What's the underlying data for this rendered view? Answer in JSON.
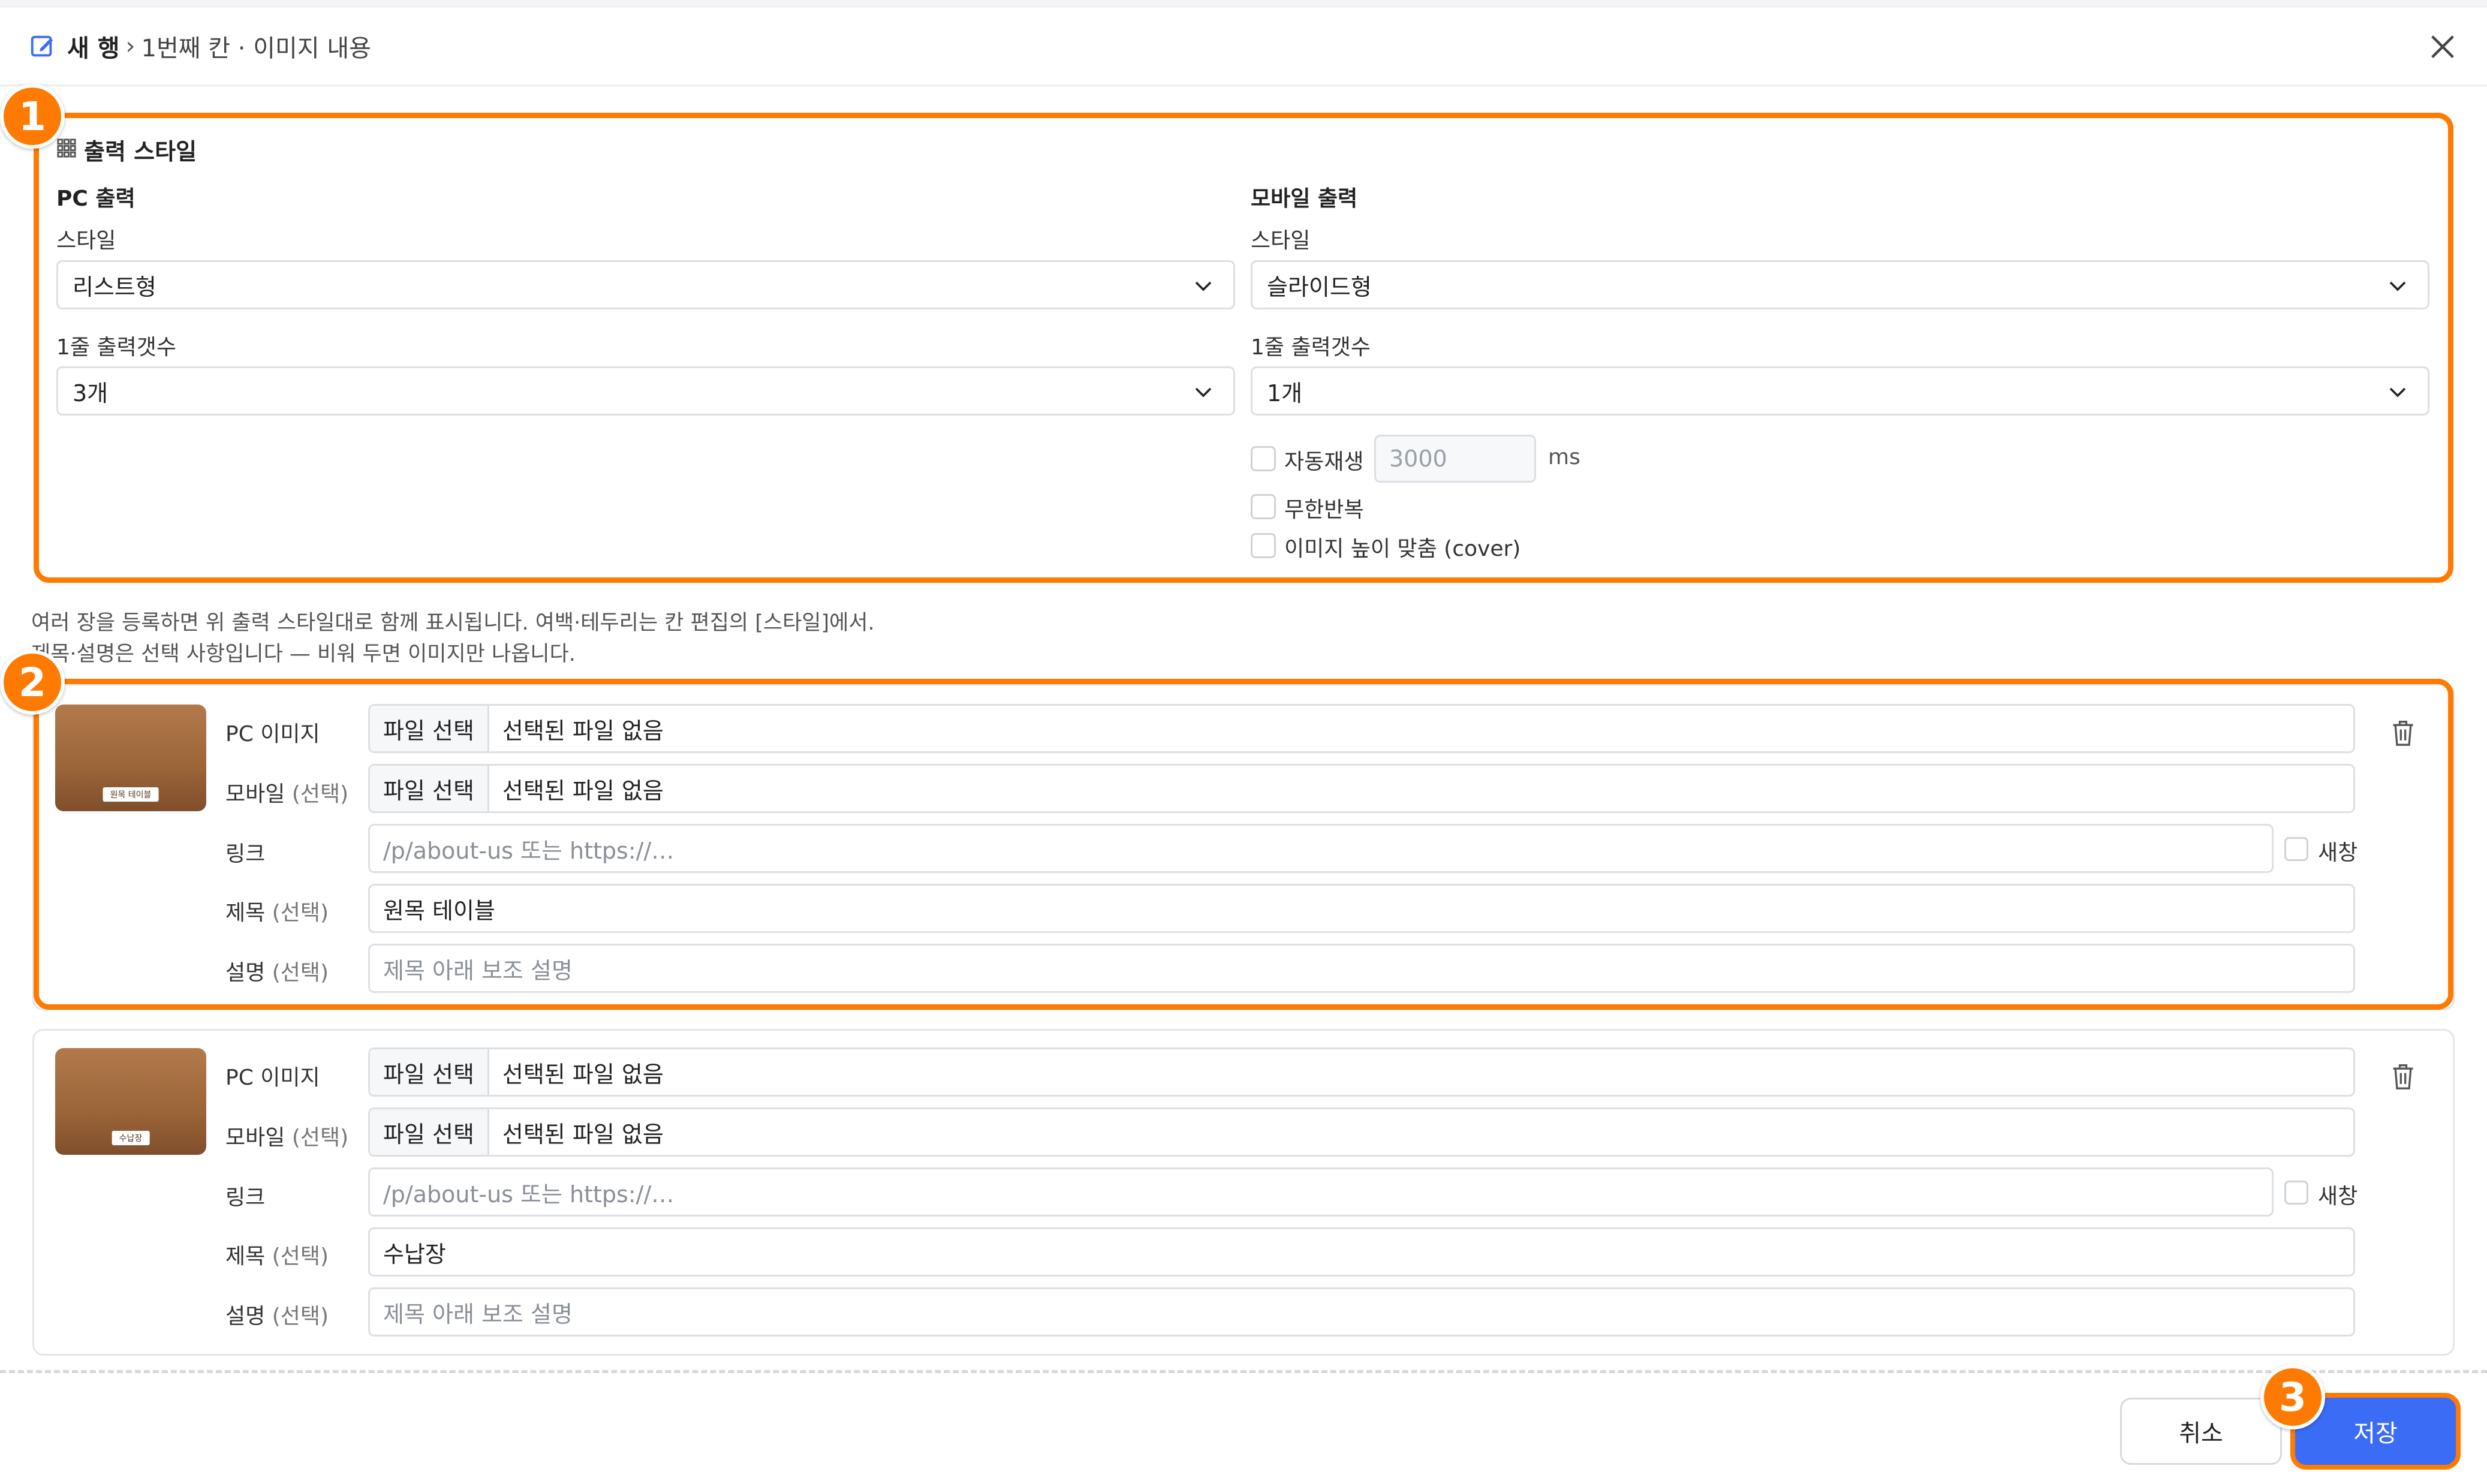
{
  "header": {
    "title": "새 행",
    "separator": "›",
    "breadcrumb": "1번째 칸 · 이미지 내용"
  },
  "style_section": {
    "title": "출력 스타일",
    "pc": {
      "heading": "PC 출력",
      "style_label": "스타일",
      "style_value": "리스트형",
      "count_label": "1줄 출력갯수",
      "count_value": "3개"
    },
    "mobile": {
      "heading": "모바일 출력",
      "style_label": "스타일",
      "style_value": "슬라이드형",
      "count_label": "1줄 출력갯수",
      "count_value": "1개",
      "autoplay_label": "자동재생",
      "autoplay_value": "3000",
      "autoplay_unit": "ms",
      "loop_label": "무한반복",
      "cover_label": "이미지 높이 맞춤 (cover)"
    }
  },
  "help_text": {
    "line1": "여러 장을 등록하면 위 출력 스타일대로 함께 표시됩니다. 여백·테두리는 칸 편집의 [스타일]에서.",
    "line2": "제목·설명은 선택 사항입니다 — 비워 두면 이미지만 나옵니다."
  },
  "labels": {
    "pc_image": "PC 이미지",
    "mobile_main": "모바일",
    "optional": "(선택)",
    "link": "링크",
    "title_main": "제목",
    "desc_main": "설명",
    "file_button": "파일 선택",
    "no_file": "선택된 파일 없음",
    "link_placeholder": "/p/about-us 또는 https://…",
    "new_window": "새창",
    "desc_placeholder": "제목 아래 보조 설명"
  },
  "items": [
    {
      "thumb_tag": "원목 테이블",
      "title_value": "원목 테이블"
    },
    {
      "thumb_tag": "수납장",
      "title_value": "수납장"
    }
  ],
  "footer": {
    "cancel": "취소",
    "save": "저장"
  },
  "badges": [
    "1",
    "2",
    "3"
  ],
  "colors": {
    "highlight": "#ff7a00",
    "primary": "#3b6cf6"
  }
}
